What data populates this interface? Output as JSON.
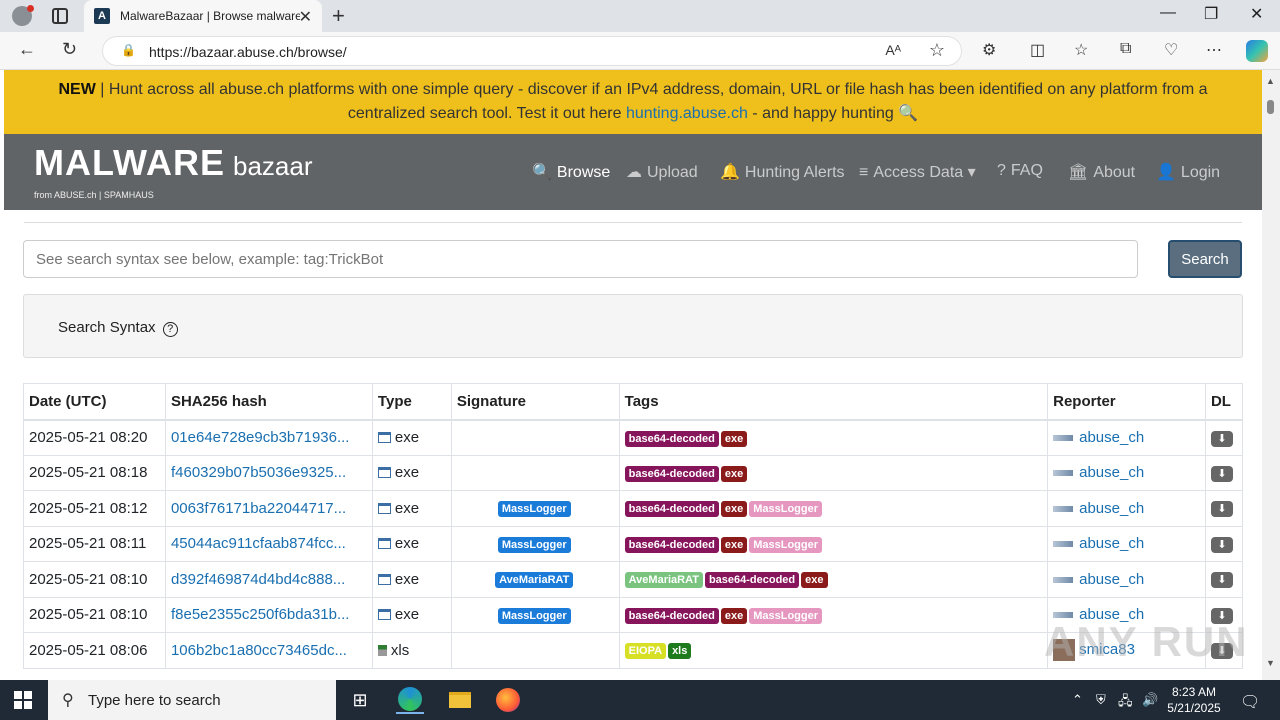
{
  "browser": {
    "tab_title": "MalwareBazaar | Browse malware",
    "tab_favicon": "A",
    "url": "https://bazaar.abuse.ch/browse/",
    "read_aloud": "Aᴬ"
  },
  "banner": {
    "new_label": "NEW",
    "text_before_link": " | Hunt across all abuse.ch platforms with one simple query - discover if an IPv4 address, domain, URL or file hash has been identified on any platform from a centralized search tool. Test it out here ",
    "link_text": "hunting.abuse.ch",
    "text_after_link": " - and happy hunting 🔍"
  },
  "logo": {
    "main": "MALWARE",
    "suffix": "bazaar",
    "sub": "from ABUSE.ch | SPAMHAUS"
  },
  "nav": {
    "browse": "Browse",
    "upload": "Upload",
    "hunting_alerts": "Hunting Alerts",
    "access_data": "Access Data",
    "faq": "FAQ",
    "about": "About",
    "login": "Login"
  },
  "search": {
    "placeholder": "See search syntax see below, example: tag:TrickBot",
    "button": "Search",
    "syntax_label": "Search Syntax"
  },
  "table": {
    "headers": [
      "Date (UTC)",
      "SHA256 hash",
      "Type",
      "Signature",
      "Tags",
      "Reporter",
      "DL"
    ],
    "rows": [
      {
        "date": "2025-05-21 08:20",
        "hash": "01e64e728e9cb3b71936...",
        "type": "exe",
        "signature": "",
        "tags": [
          "base64-decoded",
          "exe"
        ],
        "reporter": "abuse_ch"
      },
      {
        "date": "2025-05-21 08:18",
        "hash": "f460329b07b5036e9325...",
        "type": "exe",
        "signature": "",
        "tags": [
          "base64-decoded",
          "exe"
        ],
        "reporter": "abuse_ch"
      },
      {
        "date": "2025-05-21 08:12",
        "hash": "0063f76171ba22044717...",
        "type": "exe",
        "signature": "MassLogger",
        "tags": [
          "base64-decoded",
          "exe",
          "MassLogger"
        ],
        "reporter": "abuse_ch"
      },
      {
        "date": "2025-05-21 08:11",
        "hash": "45044ac911cfaab874fcc...",
        "type": "exe",
        "signature": "MassLogger",
        "tags": [
          "base64-decoded",
          "exe",
          "MassLogger"
        ],
        "reporter": "abuse_ch"
      },
      {
        "date": "2025-05-21 08:10",
        "hash": "d392f469874d4bd4c888...",
        "type": "exe",
        "signature": "AveMariaRAT",
        "tags": [
          "AveMariaRAT",
          "base64-decoded",
          "exe"
        ],
        "reporter": "abuse_ch"
      },
      {
        "date": "2025-05-21 08:10",
        "hash": "f8e5e2355c250f6bda31b...",
        "type": "exe",
        "signature": "MassLogger",
        "tags": [
          "base64-decoded",
          "exe",
          "MassLogger"
        ],
        "reporter": "abuse_ch"
      },
      {
        "date": "2025-05-21 08:06",
        "hash": "106b2bc1a80cc73465dc...",
        "type": "xls",
        "signature": "",
        "tags": [
          "EIOPA",
          "xls"
        ],
        "reporter": "smica83"
      }
    ]
  },
  "taskbar": {
    "search_text": "Type here to search",
    "time": "8:23 AM",
    "date": "5/21/2025"
  },
  "watermark": "ANY RUN",
  "colors": {
    "banner": "#efc01b",
    "navbar": "#616466",
    "link": "#1a6fb0",
    "badge_signature": "#1a7bd9",
    "badge_base64": "#86155c",
    "badge_exe": "#8b1a1a",
    "badge_masslogger_tag": "#e597c0"
  }
}
